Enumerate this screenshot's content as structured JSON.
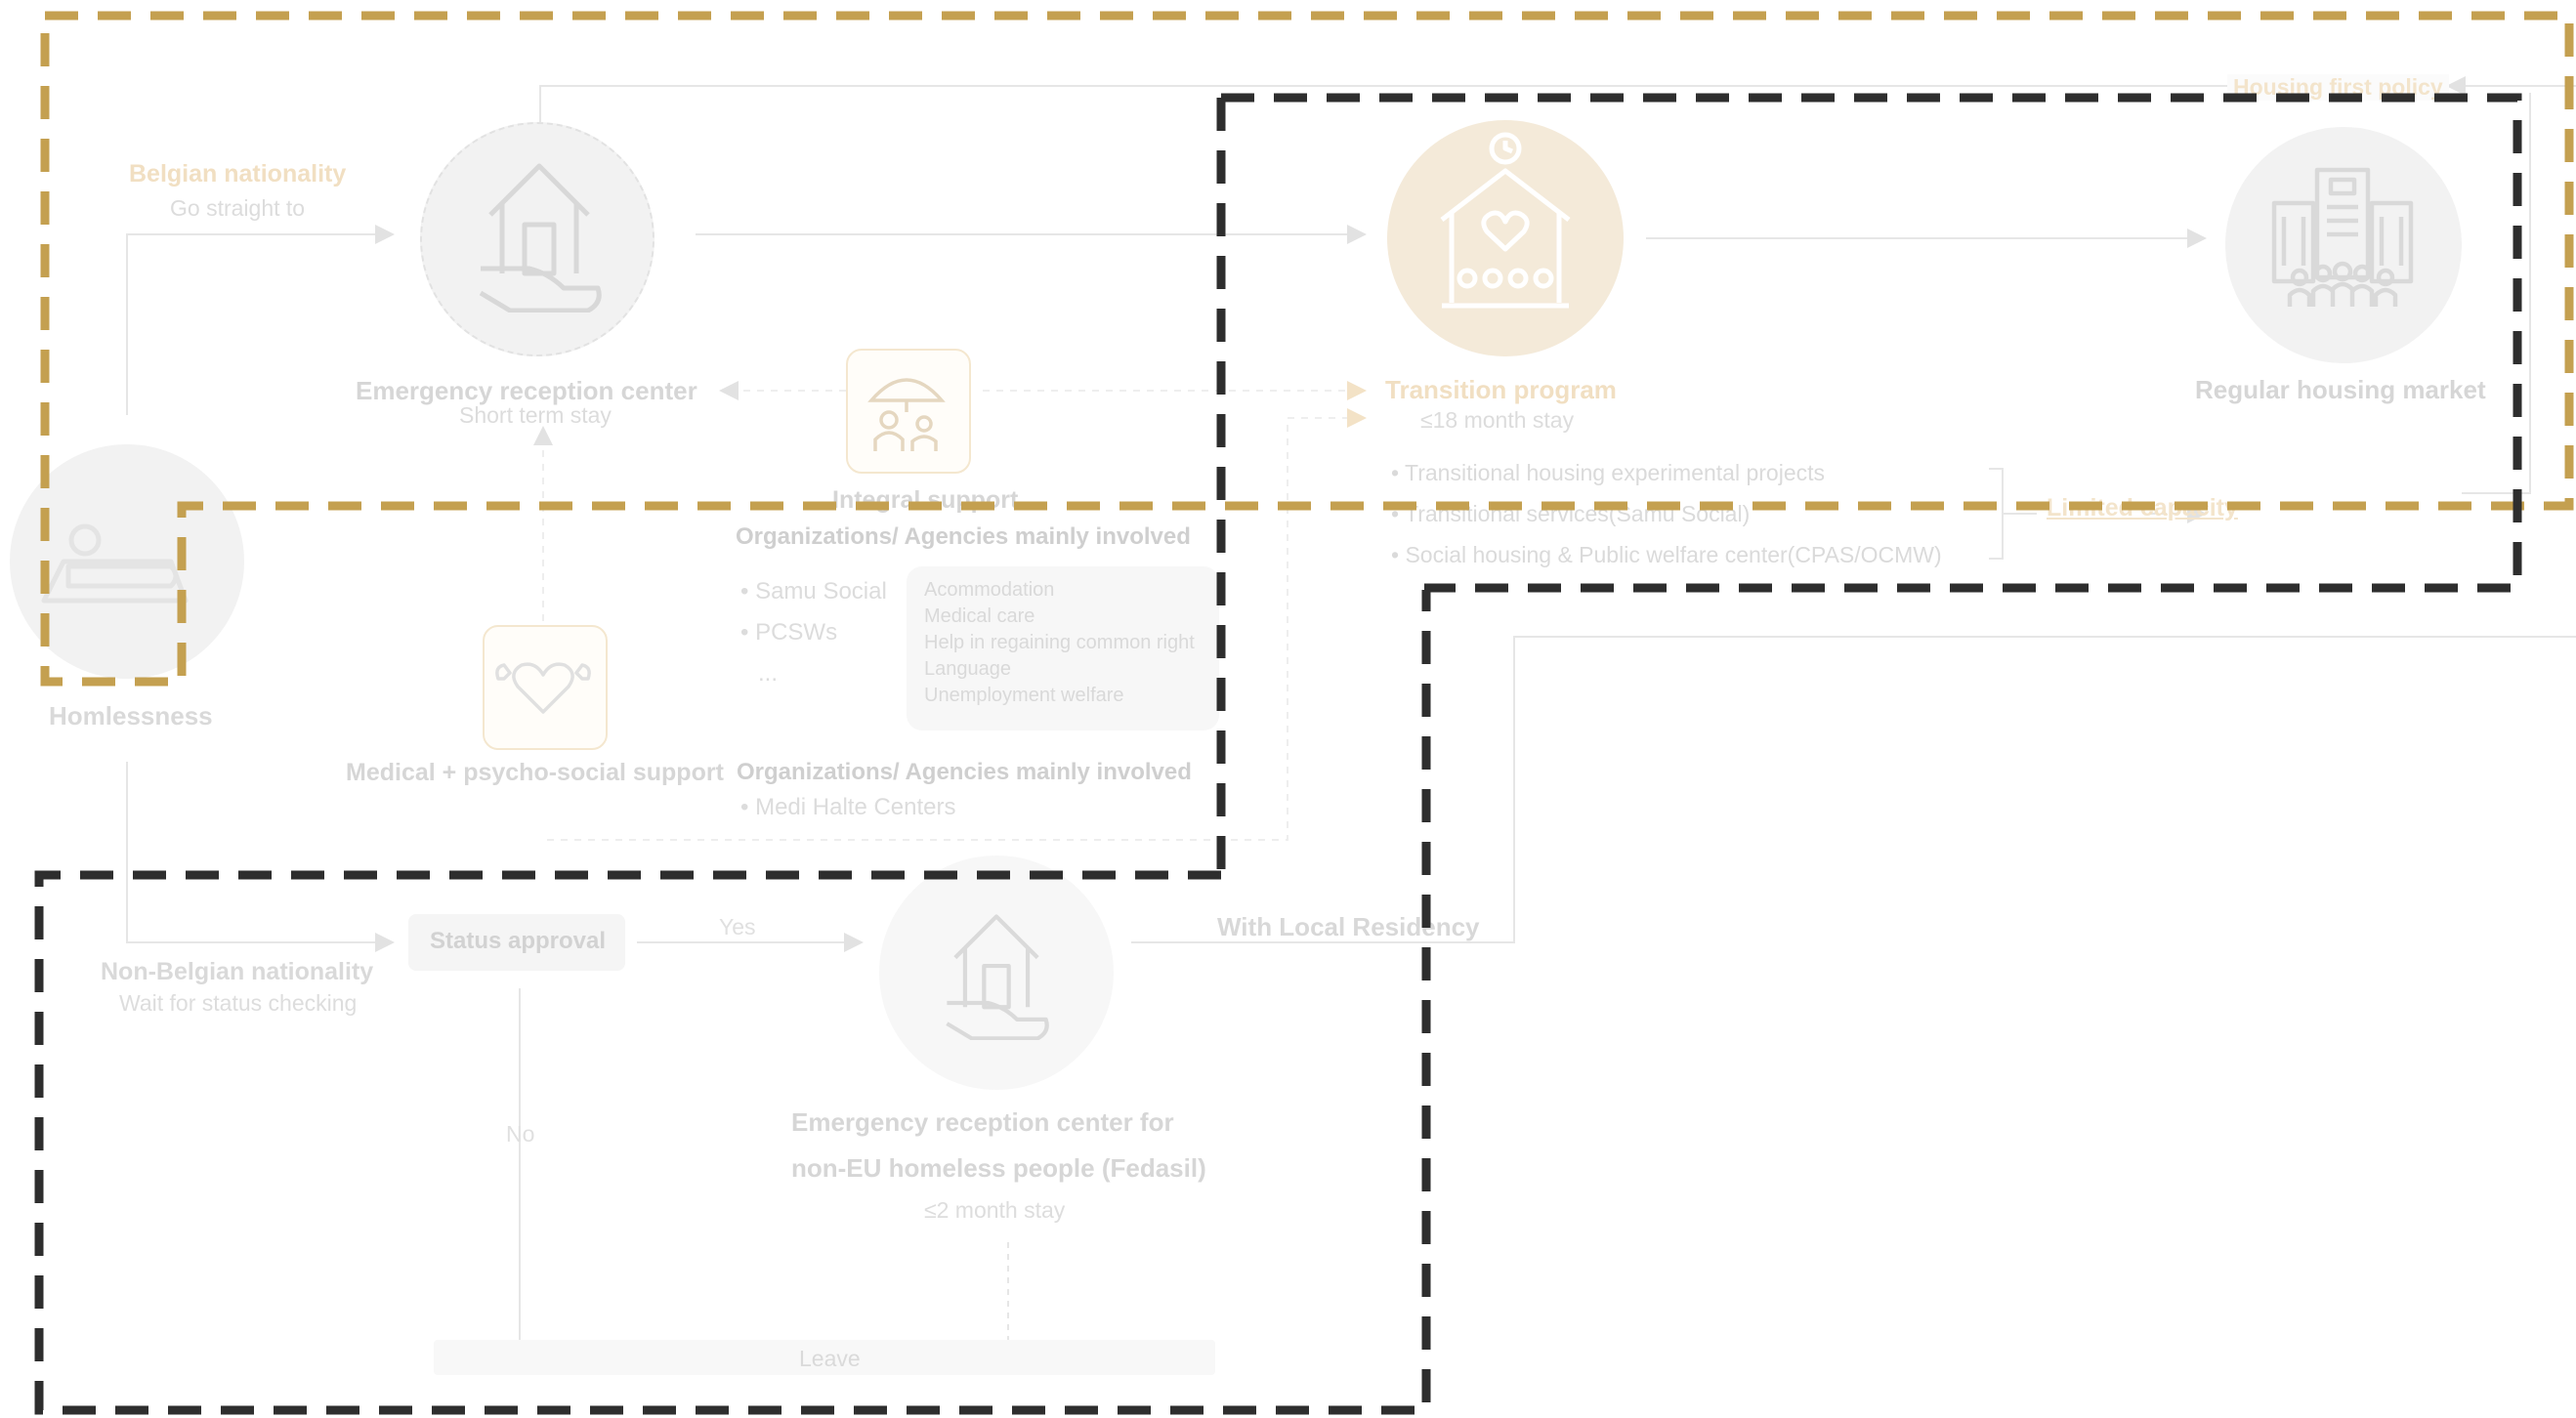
{
  "colors": {
    "accent": "#c4a050",
    "frame_dark": "#2e2e2e",
    "faded_text": "#cfcfcf",
    "faded_gold": "#f1dfc2",
    "circle_fill": "#f2f2f2",
    "highlight_circle": "#f4ead9"
  },
  "homelessness": {
    "label": "Homlessness",
    "icon": "sleeping-person-icon"
  },
  "belgian": {
    "title": "Belgian nationality",
    "subtitle": "Go straight to"
  },
  "non_belgian": {
    "title": "Non-Belgian nationality",
    "subtitle": "Wait for status checking"
  },
  "emergency_center": {
    "title": "Emergency reception center",
    "subtitle": "Short term stay",
    "icon": "hand-house-icon"
  },
  "integral_support": {
    "title": "Integral support",
    "icon": "umbrella-people-icon",
    "orgs_heading": "Organizations/ Agencies mainly involved",
    "orgs": [
      "Samu Social",
      "PCSWs",
      "..."
    ],
    "services": [
      "Acommodation",
      "Medical care",
      "Help in regaining common right",
      "Language",
      "Unemployment welfare"
    ]
  },
  "medical_support": {
    "title": "Medical + psycho-social support",
    "icon": "heart-muscle-icon",
    "orgs_heading": "Organizations/ Agencies mainly involved",
    "orgs": [
      "Medi Halte Centers"
    ]
  },
  "transition": {
    "title": "Transition program",
    "subtitle": "≤18 month stay",
    "icon": "house-heart-community-icon",
    "items": [
      "Transitional housing experimental projects",
      "Transitional services(Samu Social)",
      "Social housing & Public welfare center(CPAS/OCMW)"
    ]
  },
  "limited_capacity": "Limited capacity",
  "housing_first": "Housing first policy",
  "regular_housing": {
    "title": "Regular housing market",
    "icon": "apartment-building-icon"
  },
  "status_approval": "Status approval",
  "yes": "Yes",
  "no": "No",
  "local_residency": "With Local Residency",
  "fedasil": {
    "line1": "Emergency reception center for",
    "line2": "non-EU homeless people (Fedasil)",
    "subtitle": "≤2 month stay",
    "icon": "hand-house-icon"
  },
  "leave": "Leave"
}
